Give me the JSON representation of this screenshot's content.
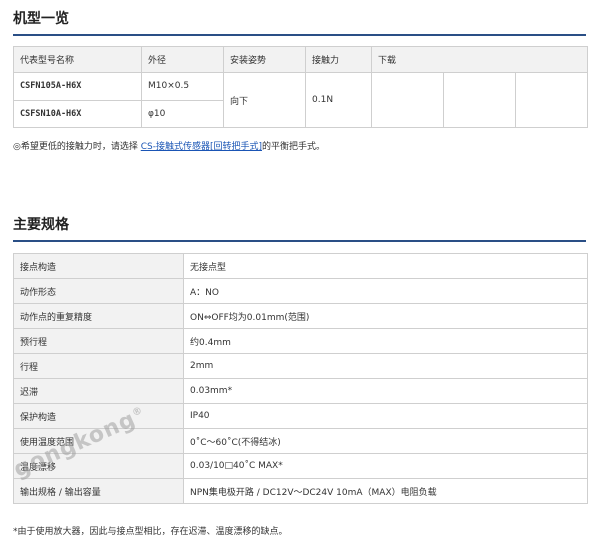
{
  "models_section": {
    "title": "机型一览",
    "headers": [
      "代表型号名称",
      "外径",
      "安装姿势",
      "接触力",
      "下载"
    ],
    "rows": [
      {
        "model": "CSFN105A-H6X",
        "diameter": "M10×0.5"
      },
      {
        "model": "CSFSN10A-H6X",
        "diameter": "φ10"
      }
    ],
    "mount": "向下",
    "force": "0.1N",
    "note_prefix": "◎希望更低的接触力时，请选择",
    "note_link": "CS-接触式传感器[回转把手式]",
    "note_suffix": "的平衡把手式。"
  },
  "spec_section": {
    "title": "主要规格",
    "rows": [
      {
        "key": "接点构造",
        "value": "无接点型"
      },
      {
        "key": "动作形态",
        "value": "A：NO"
      },
      {
        "key": "动作点的重复精度",
        "value": "ON⇔OFF均为0.01mm(范围)"
      },
      {
        "key": "预行程",
        "value": "约0.4mm"
      },
      {
        "key": "行程",
        "value": "2mm"
      },
      {
        "key": "迟滞",
        "value": "0.03mm*"
      },
      {
        "key": "保护构造",
        "value": "IP40"
      },
      {
        "key": "使用温度范围",
        "value": "0˚C～60˚C(不得结冰)"
      },
      {
        "key": "温度漂移",
        "value": "0.03/10□40˚C MAX*"
      },
      {
        "key": "输出规格 / 输出容量",
        "value": "NPN集电极开路 / DC12V～DC24V 10mA（MAX）电阻负载"
      }
    ],
    "footnote": "*由于使用放大器，因此与接点型相比，存在迟滞、温度漂移的缺点。"
  },
  "watermark": {
    "text": "gongkong",
    "mark": "®"
  }
}
